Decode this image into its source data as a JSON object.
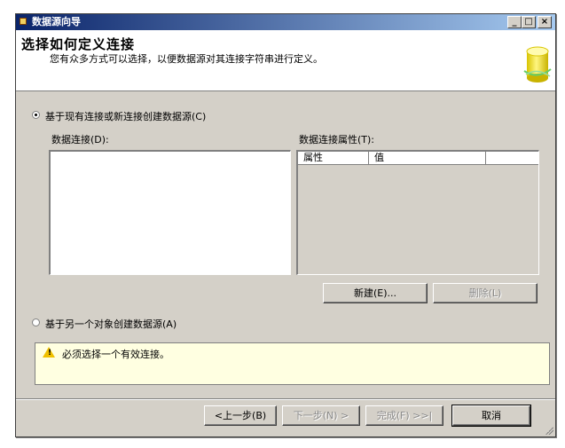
{
  "window": {
    "title": "数据源向导"
  },
  "caption_buttons": {
    "minimize": "_",
    "maximize": "□",
    "close": "×"
  },
  "header": {
    "title": "选择如何定义连接",
    "subtitle": "您有众多方式可以选择，以便数据源对其连接字符串进行定义。"
  },
  "option_existing": {
    "label": "基于现有连接或新连接创建数据源(C)",
    "selected": true
  },
  "connections": {
    "label": "数据连接(D):",
    "items": []
  },
  "properties": {
    "label": "数据连接属性(T):",
    "columns": [
      "属性",
      "值"
    ]
  },
  "buttons": {
    "new": "新建(E)...",
    "delete": "删除(L)"
  },
  "option_other": {
    "label": "基于另一个对象创建数据源(A)",
    "selected": false
  },
  "message": {
    "icon": "warning-icon",
    "text": "必须选择一个有效连接。"
  },
  "footer": {
    "back": "<上一步(B)",
    "next": "下一步(N) >",
    "finish": "完成(F) >>|",
    "cancel": "取消"
  }
}
